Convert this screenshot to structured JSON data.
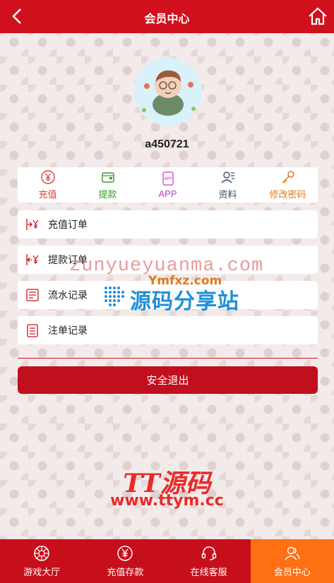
{
  "header": {
    "title": "会员中心",
    "back_icon": "chevron-left-icon",
    "home_icon": "home-icon"
  },
  "profile": {
    "username": "a450721",
    "avatar": "cartoon-boy-avatar"
  },
  "quick_actions": [
    {
      "label": "充值",
      "icon": "yuan-circle-icon",
      "color": "#e23b3b"
    },
    {
      "label": "提款",
      "icon": "wallet-icon",
      "color": "#3c9a2a"
    },
    {
      "label": "APP",
      "icon": "app-phone-icon",
      "color": "#c83bc6"
    },
    {
      "label": "资料",
      "icon": "profile-icon",
      "color": "#3b4d66"
    },
    {
      "label": "修改密码",
      "icon": "key-icon",
      "color": "#e07b1e"
    }
  ],
  "menu": [
    {
      "label": "充值订单",
      "icon": "deposit-order-icon"
    },
    {
      "label": "提款订单",
      "icon": "withdraw-order-icon"
    },
    {
      "label": "流水记录",
      "icon": "flow-record-icon"
    },
    {
      "label": "注单记录",
      "icon": "bet-record-icon"
    }
  ],
  "logout_label": "安全退出",
  "watermarks": {
    "url_text": "zunyueyuanma.com",
    "site_top": "Ymfxz.com",
    "site_main": "源码分享站",
    "brand_logo": "TT源码",
    "brand_url": "www.ttym.cc"
  },
  "tabbar": [
    {
      "label": "游戏大厅",
      "icon": "games-icon",
      "active": false
    },
    {
      "label": "充值存款",
      "icon": "deposit-icon",
      "active": false
    },
    {
      "label": "在线客服",
      "icon": "headset-icon",
      "active": false
    },
    {
      "label": "会员中心",
      "icon": "member-icon",
      "active": true
    }
  ],
  "colors": {
    "primary": "#d0101c",
    "active_tab": "#ff6f14"
  }
}
